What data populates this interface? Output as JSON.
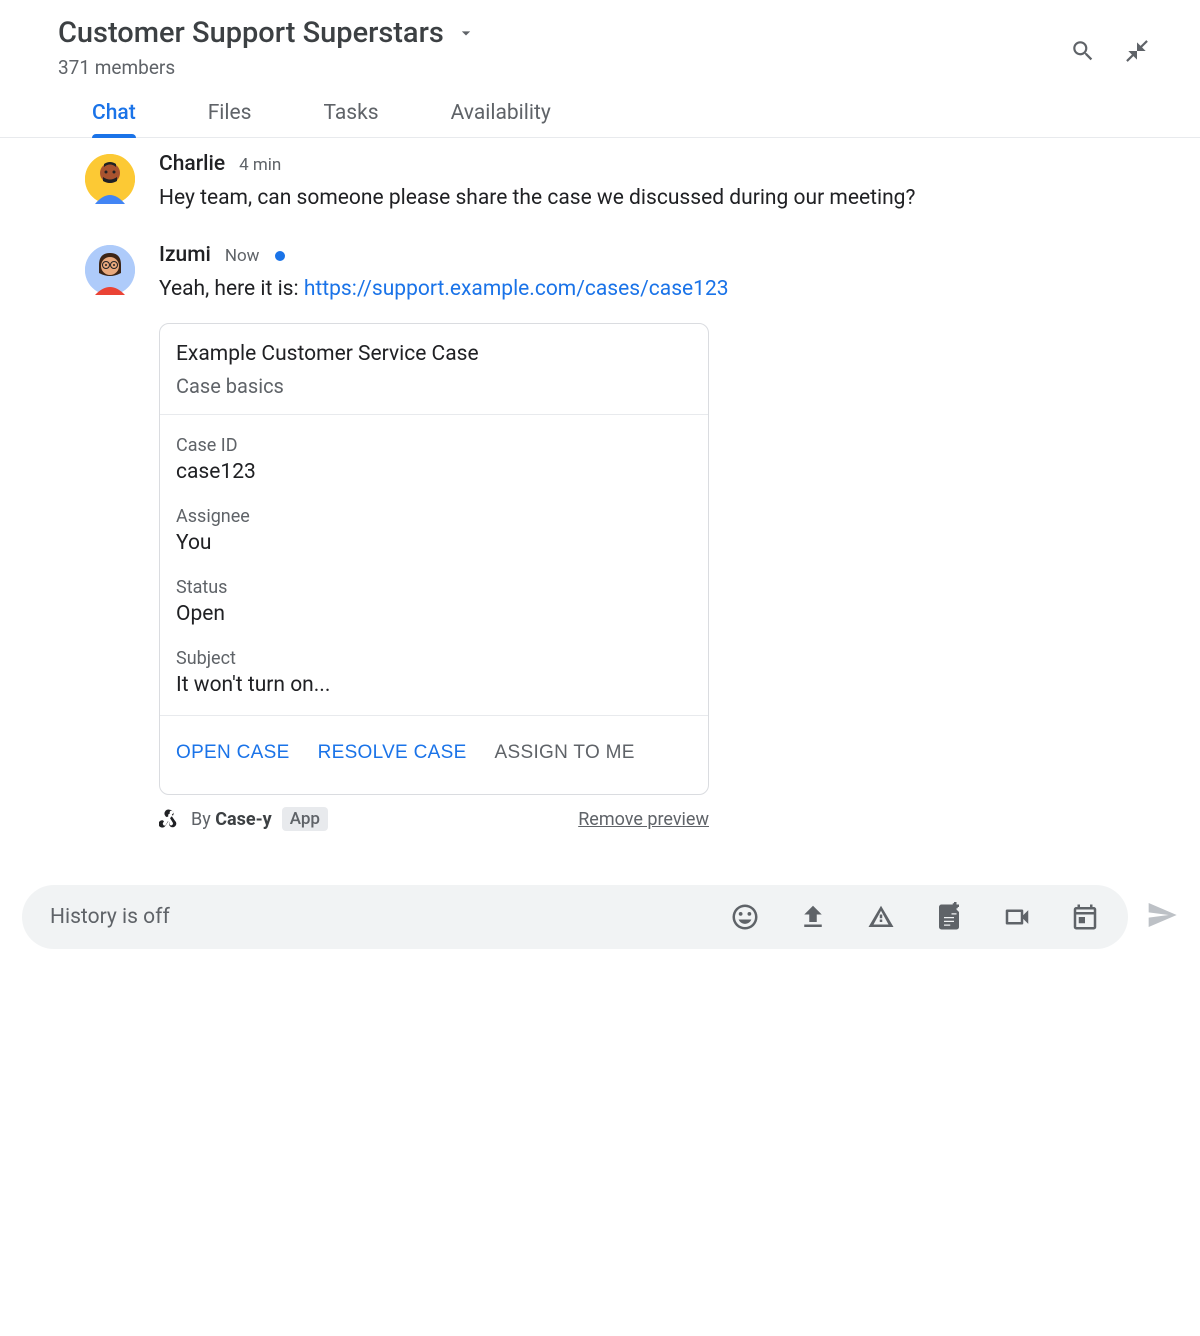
{
  "header": {
    "title": "Customer Support Superstars",
    "members": "371 members"
  },
  "tabs": [
    {
      "label": "Chat",
      "active": true
    },
    {
      "label": "Files",
      "active": false
    },
    {
      "label": "Tasks",
      "active": false
    },
    {
      "label": "Availability",
      "active": false
    }
  ],
  "messages": [
    {
      "sender": "Charlie",
      "time": "4 min",
      "unread": false,
      "text": "Hey team, can someone please share the case we discussed during our meeting?"
    },
    {
      "sender": "Izumi",
      "time": "Now",
      "unread": true,
      "text_prefix": "Yeah, here it is: ",
      "link": "https://support.example.com/cases/case123"
    }
  ],
  "card": {
    "title": "Example Customer Service Case",
    "subtitle": "Case basics",
    "fields": [
      {
        "label": "Case ID",
        "value": "case123"
      },
      {
        "label": "Assignee",
        "value": "You"
      },
      {
        "label": "Status",
        "value": "Open"
      },
      {
        "label": "Subject",
        "value": "It won't turn on..."
      }
    ],
    "actions": [
      {
        "label": "OPEN CASE",
        "style": "primary"
      },
      {
        "label": "RESOLVE CASE",
        "style": "primary"
      },
      {
        "label": "ASSIGN TO ME",
        "style": "muted"
      }
    ],
    "attribution_prefix": "By ",
    "attribution_app": "Case-y",
    "app_badge": "App",
    "remove_label": "Remove preview"
  },
  "compose": {
    "placeholder": "History is off"
  }
}
